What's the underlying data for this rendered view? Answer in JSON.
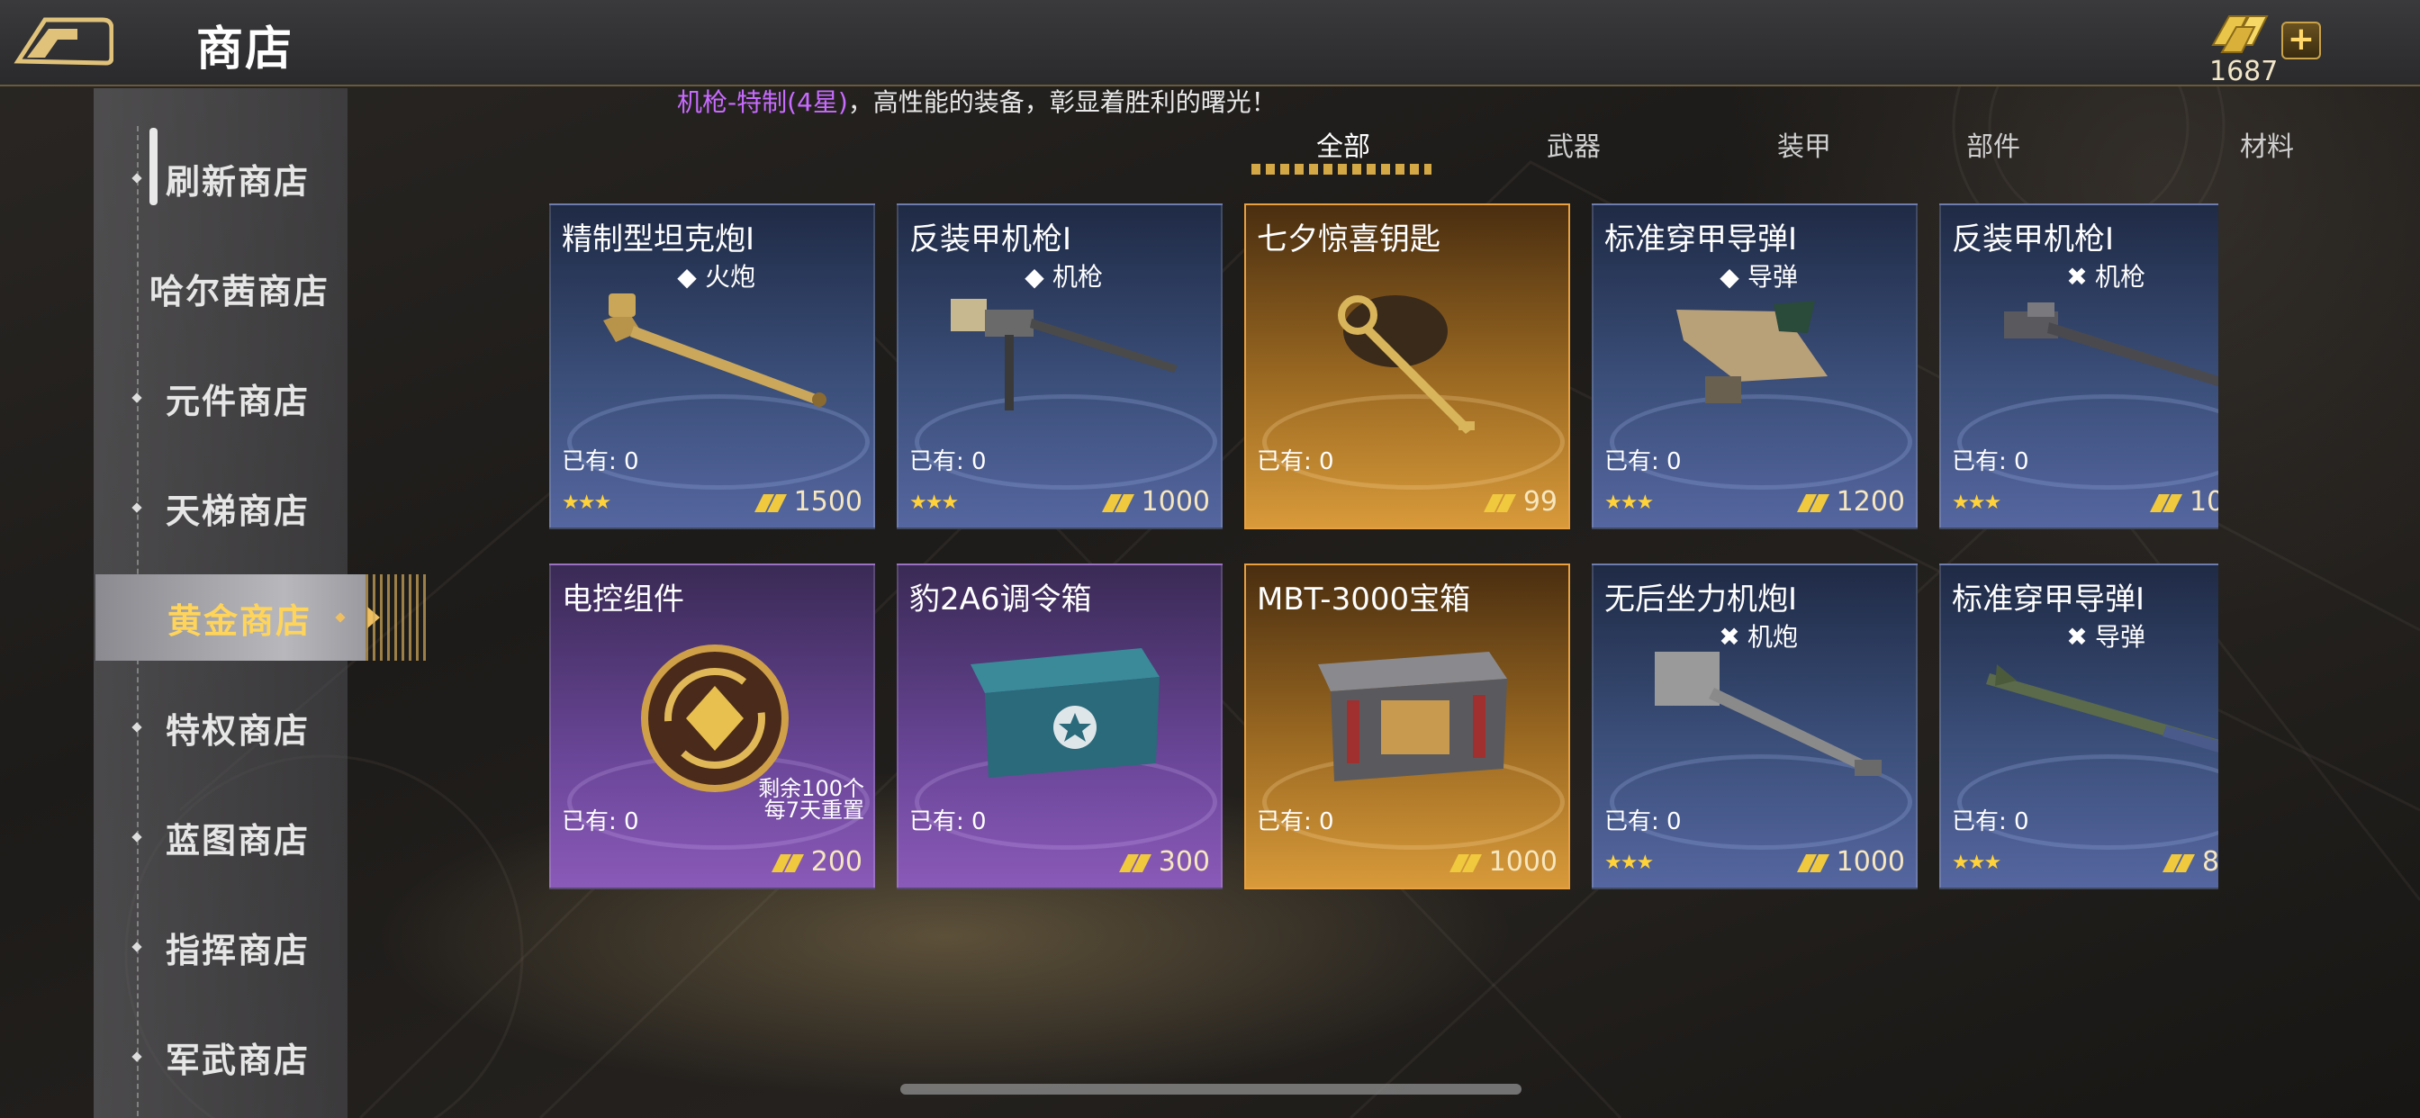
{
  "header": {
    "title": "商店",
    "gold_amount": "1687",
    "plus": "+"
  },
  "marquee": {
    "highlight": "机枪-特制(4星)",
    "text": "，高性能的装备，彰显着胜利的曙光！"
  },
  "sidebar": {
    "items": [
      {
        "label": "刷新商店"
      },
      {
        "label": "哈尔茜商店"
      },
      {
        "label": "元件商店"
      },
      {
        "label": "天梯商店"
      },
      {
        "label": "黄金商店",
        "active": true
      },
      {
        "label": "特权商店"
      },
      {
        "label": "蓝图商店"
      },
      {
        "label": "指挥商店"
      },
      {
        "label": "军武商店"
      }
    ]
  },
  "tabs": [
    {
      "label": "全部",
      "active": true
    },
    {
      "label": "武器"
    },
    {
      "label": "装甲"
    },
    {
      "label": "部件"
    },
    {
      "label": "材料"
    }
  ],
  "cards": [
    {
      "name": "精制型坦克炮I",
      "type_symbol": "◆",
      "type": "火炮",
      "owned": "已有: 0",
      "stars": "★★★",
      "price": "1500",
      "rarity": "blue"
    },
    {
      "name": "反装甲机枪I",
      "type_symbol": "◆",
      "type": "机枪",
      "owned": "已有: 0",
      "stars": "★★★",
      "price": "1000",
      "rarity": "blue"
    },
    {
      "name": "七夕惊喜钥匙",
      "type_symbol": "",
      "type": "",
      "owned": "已有: 0",
      "stars": "",
      "price": "99",
      "rarity": "gold"
    },
    {
      "name": "标准穿甲导弹I",
      "type_symbol": "◆",
      "type": "导弹",
      "owned": "已有: 0",
      "stars": "★★★",
      "price": "1200",
      "rarity": "blue"
    },
    {
      "name": "反装甲机枪I",
      "type_symbol": "✖",
      "type": "机枪",
      "owned": "已有: 0",
      "stars": "★★★",
      "price": "10",
      "rarity": "blue"
    },
    {
      "name": "电控组件",
      "type_symbol": "",
      "type": "",
      "owned": "已有: 0",
      "stars": "",
      "price": "200",
      "rarity": "purple",
      "extra1": "剩余100个",
      "extra2": "每7天重置"
    },
    {
      "name": "豹2A6调令箱",
      "type_symbol": "",
      "type": "",
      "owned": "已有: 0",
      "stars": "",
      "price": "300",
      "rarity": "purple"
    },
    {
      "name": "MBT-3000宝箱",
      "type_symbol": "",
      "type": "",
      "owned": "已有: 0",
      "stars": "",
      "price": "1000",
      "rarity": "gold"
    },
    {
      "name": "无后坐力机炮I",
      "type_symbol": "✖",
      "type": "机炮",
      "owned": "已有: 0",
      "stars": "★★★",
      "price": "1000",
      "rarity": "blue"
    },
    {
      "name": "标准穿甲导弹I",
      "type_symbol": "✖",
      "type": "导弹",
      "owned": "已有: 0",
      "stars": "★★★",
      "price": "8",
      "rarity": "blue"
    }
  ],
  "icons": {
    "back": "back-arrow-icon",
    "gold": "gold-bars-icon",
    "star_rating": "star-icon"
  },
  "colors": {
    "accent_gold": "#ffd45a",
    "card_blue": "#3b4f7a",
    "card_purple": "#6a4698",
    "card_gold": "#9c6a22",
    "marquee_highlight": "#c86bff"
  }
}
